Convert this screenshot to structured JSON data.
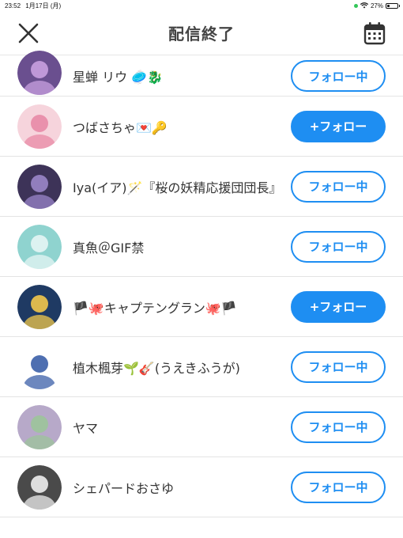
{
  "status": {
    "time": "23:52",
    "date": "1月17日 (月)",
    "battery": "27%",
    "battery_level": 0.27
  },
  "header": {
    "title": "配信終了",
    "close_icon": "close-icon",
    "calendar_icon": "calendar-icon"
  },
  "users": [
    {
      "name": "星蝉 リウ 🥏🐉",
      "button": "フォロー中",
      "state": "following",
      "avatar_bg": "#6a4f8f",
      "avatar_fg": "#c9a0e0"
    },
    {
      "name": "つばさちゃ💌🔑",
      "button": "+フォロー",
      "state": "follow",
      "avatar_bg": "#f6d4dc",
      "avatar_fg": "#e88aa6"
    },
    {
      "name": "Iya(イア)🪄『桜の妖精応援団団長』",
      "button": "フォロー中",
      "state": "following",
      "avatar_bg": "#3d3358",
      "avatar_fg": "#9a86c9"
    },
    {
      "name": "真魚＠GIF禁",
      "button": "フォロー中",
      "state": "following",
      "avatar_bg": "#8fd3cf",
      "avatar_fg": "#e6f5f4"
    },
    {
      "name": "🏴🐙キャプテングラン🐙🏴",
      "button": "+フォロー",
      "state": "follow",
      "avatar_bg": "#1f3a63",
      "avatar_fg": "#f2c84b"
    },
    {
      "name": "植木楓芽🌱🎸(うえきふうが)",
      "button": "フォロー中",
      "state": "following",
      "avatar_bg": "#ffffff",
      "avatar_fg": "#3b5fa8"
    },
    {
      "name": "ヤマ",
      "button": "フォロー中",
      "state": "following",
      "avatar_bg": "#b7a9c9",
      "avatar_fg": "#9cc49a"
    },
    {
      "name": "シェパードおさゆ",
      "button": "フォロー中",
      "state": "following",
      "avatar_bg": "#4a4a4a",
      "avatar_fg": "#eeeeee"
    }
  ],
  "colors": {
    "accent": "#1e8ef2",
    "divider": "#e4e4e4",
    "title": "#444444"
  }
}
